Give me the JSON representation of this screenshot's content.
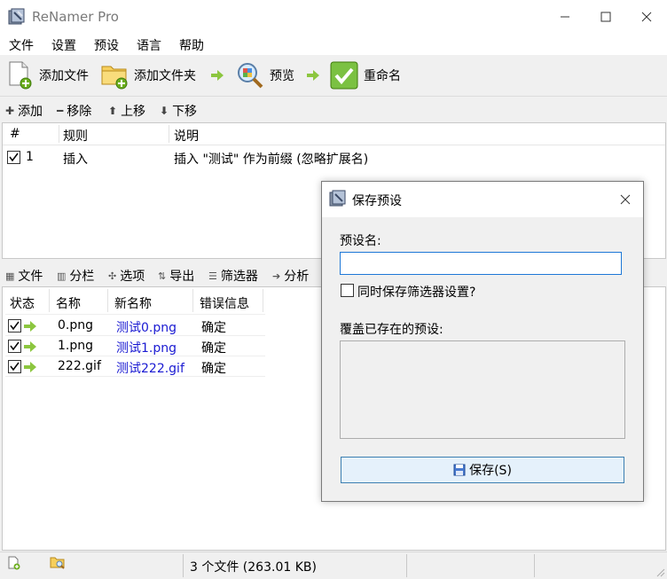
{
  "window": {
    "title": "ReNamer Pro"
  },
  "menu": [
    "文件",
    "设置",
    "预设",
    "语言",
    "帮助"
  ],
  "toolbar": {
    "add_files": "添加文件",
    "add_folders": "添加文件夹",
    "preview": "预览",
    "rename": "重命名"
  },
  "rules_toolbar": {
    "add": "添加",
    "remove": "移除",
    "up": "上移",
    "down": "下移"
  },
  "rules": {
    "columns": [
      "#",
      "规则",
      "说明"
    ],
    "rows": [
      {
        "num": "1",
        "rule": "插入",
        "desc": "插入 \"测试\" 作为前缀 (忽略扩展名)",
        "checked": true
      }
    ]
  },
  "files_toolbar": {
    "files": "文件",
    "columns": "分栏",
    "options": "选项",
    "export": "导出",
    "filters": "筛选器",
    "analyze": "分析"
  },
  "files": {
    "columns": [
      "状态",
      "名称",
      "新名称",
      "错误信息"
    ],
    "rows": [
      {
        "name": "0.png",
        "new_name": "测试0.png",
        "error": "确定"
      },
      {
        "name": "1.png",
        "new_name": "测试1.png",
        "error": "确定"
      },
      {
        "name": "222.gif",
        "new_name": "测试222.gif",
        "error": "确定"
      }
    ]
  },
  "statusbar": {
    "summary": "3 个文件 (263.01 KB)"
  },
  "dialog": {
    "title": "保存预设",
    "preset_name_label": "预设名:",
    "preset_name_value": "",
    "save_filters_label": "同时保存筛选器设置?",
    "overwrite_label": "覆盖已存在的预设:",
    "save_button": "保存(S)"
  },
  "colors": {
    "new_name": "#1a1ad2",
    "accent": "#1e78d7",
    "check_green": "#6cae1e"
  }
}
